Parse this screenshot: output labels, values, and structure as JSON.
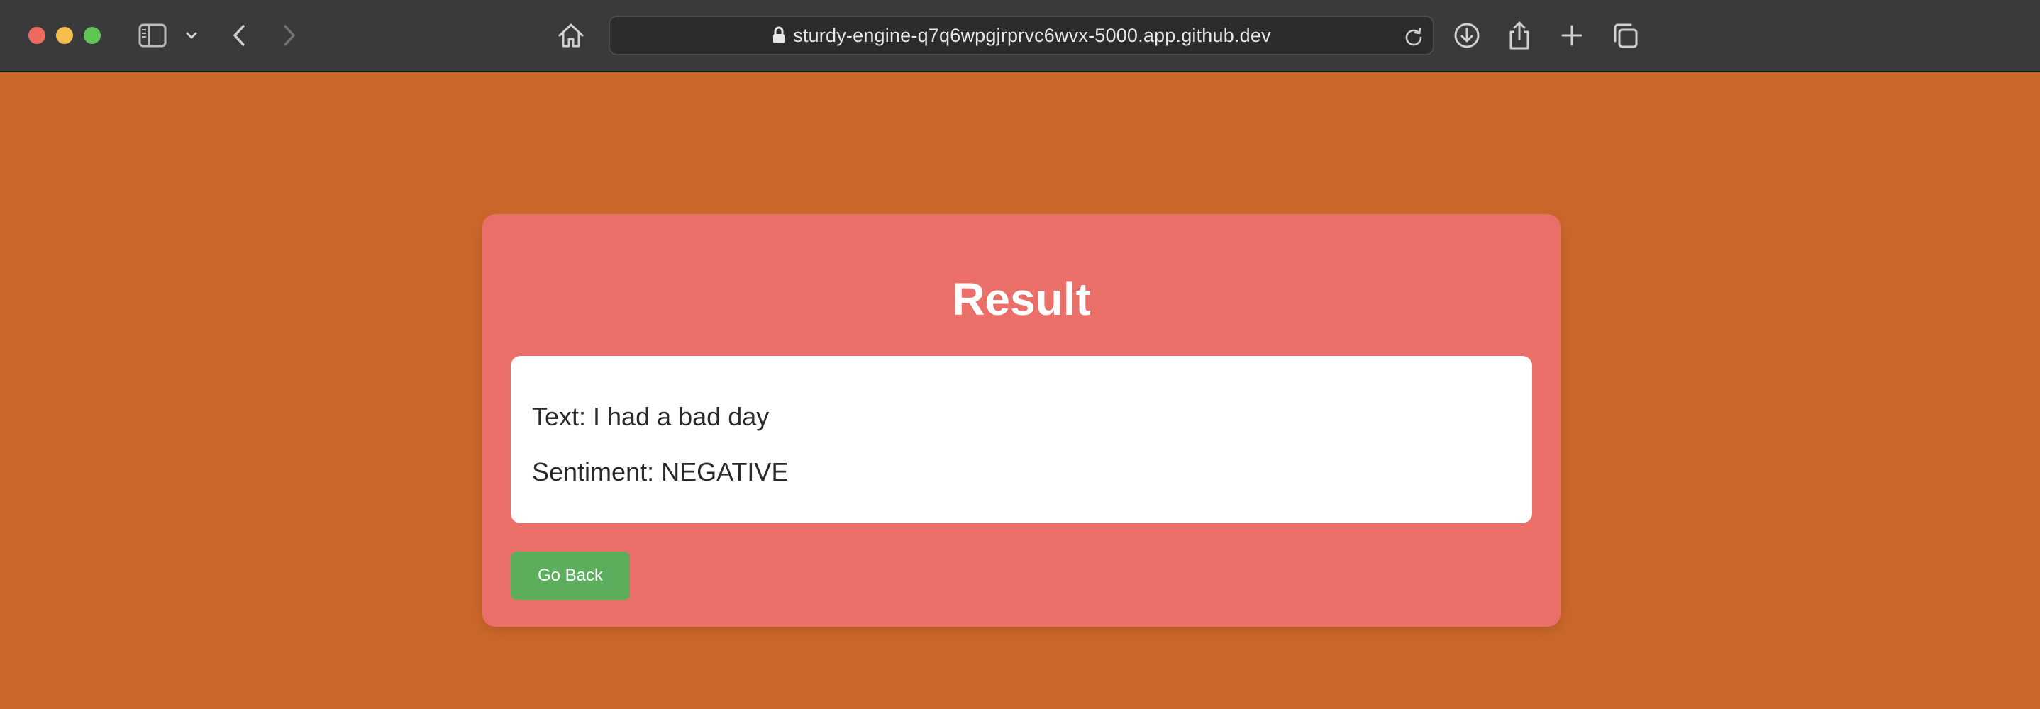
{
  "browser": {
    "url": "sturdy-engine-q7q6wpgjrprvc6wvx-5000.app.github.dev",
    "icons": {
      "sidebar": "sidebar-icon",
      "sidebar_menu": "chevron-down-icon",
      "back": "chevron-left-icon",
      "forward": "chevron-right-icon",
      "home": "home-icon",
      "lock": "lock-icon",
      "reload": "reload-icon",
      "downloads": "download-icon",
      "share": "share-icon",
      "new_tab": "plus-icon",
      "tabs": "tabs-overview-icon"
    }
  },
  "page": {
    "title": "Result",
    "text_line": "Text: I had a bad day",
    "sentiment_line": "Sentiment: NEGATIVE",
    "back_button": "Go Back"
  },
  "colors": {
    "page_background": "#cb672b",
    "card_background": "#e96f68",
    "button_background": "#5cad5c"
  }
}
